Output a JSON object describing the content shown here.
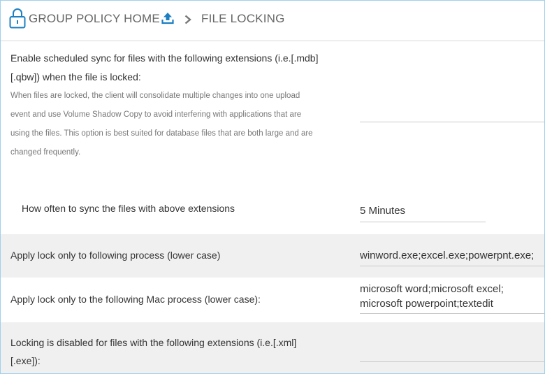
{
  "header": {
    "breadcrumb_home": "GROUP POLICY HOME",
    "breadcrumb_current": "FILE LOCKING",
    "icons": [
      "lock-icon",
      "upload-icon",
      "chevron-right-icon"
    ],
    "accent_color": "#1c7fc1"
  },
  "settings": {
    "scheduled_sync": {
      "label_line1": "Enable scheduled sync for files with the following extensions (i.e.[.mdb]",
      "label_line2": "[.qbw]) when the file is locked:",
      "desc_line1": "When files are locked, the client will consolidate multiple changes into one upload",
      "desc_line2": "event and use Volume Shadow Copy to avoid interfering with applications that are",
      "desc_line3": "using the files. This option is best suited for database files that are both large and are",
      "desc_line4": "changed frequently.",
      "value": ""
    },
    "sync_frequency": {
      "label": "How often to sync the files with above extensions",
      "value": "5 Minutes"
    },
    "lock_process": {
      "label": "Apply lock only to following process (lower case)",
      "value": "winword.exe;excel.exe;powerpnt.exe;"
    },
    "mac_process": {
      "label": "Apply lock only to the following Mac process (lower case):",
      "value": "microsoft word;microsoft excel;\nmicrosoft powerpoint;textedit"
    },
    "disabled_extensions": {
      "label_line1": "Locking is disabled for files with the following extensions (i.e.[.xml]",
      "label_line2": "[.exe]):",
      "value": ""
    }
  }
}
